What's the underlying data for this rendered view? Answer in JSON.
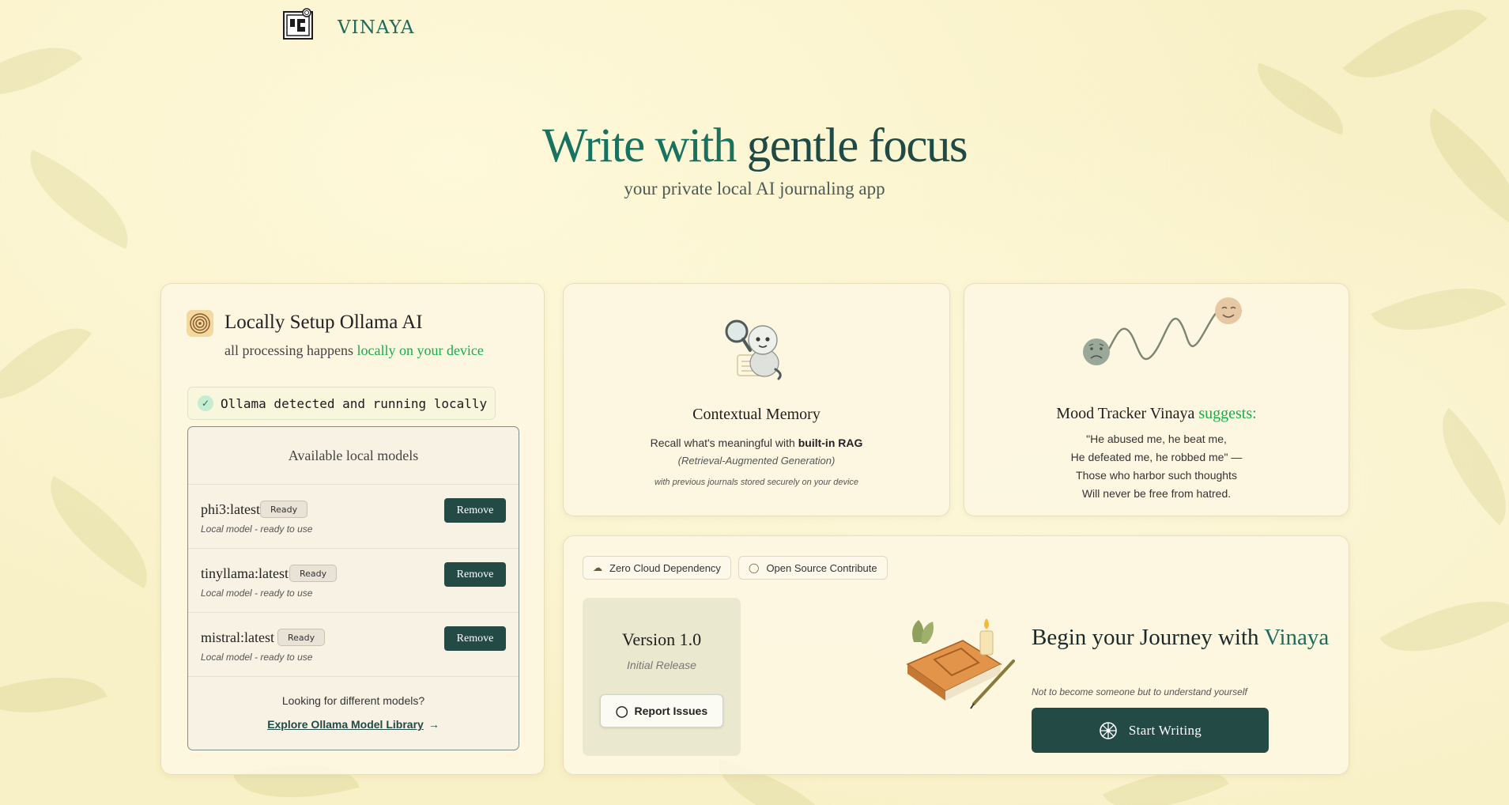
{
  "header": {
    "brand": "VINAYA"
  },
  "hero": {
    "title_part1": "Write with",
    "title_part2": " gentle focus",
    "subtitle": "your private local AI journaling app"
  },
  "ollama": {
    "title": "Locally Setup Ollama AI",
    "subtitle_prefix": "all processing happens ",
    "subtitle_highlight": "locally on your device",
    "status": "Ollama detected and running locally",
    "models_heading": "Available local models",
    "models": [
      {
        "name": "phi3:latest",
        "badge": "Ready",
        "desc": "Local model - ready to use",
        "action": "Remove"
      },
      {
        "name": "tinyllama:latest",
        "badge": "Ready",
        "desc": "Local model - ready to use",
        "action": "Remove"
      },
      {
        "name": "mistral:latest",
        "badge": "Ready",
        "desc": "Local model - ready to use",
        "action": "Remove"
      }
    ],
    "looking_text": "Looking for different models?",
    "explore_link": "Explore Ollama Model Library"
  },
  "memory": {
    "title": "Contextual Memory",
    "desc_prefix": "Recall what's meaningful with ",
    "desc_bold": "built-in RAG",
    "paren": "(Retrieval-Augmented Generation)",
    "note": "with previous journals stored securely on your device"
  },
  "mood": {
    "title_prefix": "Mood Tracker Vinaya ",
    "title_highlight": "suggests:",
    "quote_lines": [
      "\"He abused me, he beat me,",
      "He defeated me, he robbed me\" —",
      "Those who harbor such thoughts",
      "Will never be free from hatred."
    ]
  },
  "journey": {
    "pills": [
      "Zero Cloud Dependency",
      "Open Source Contribute"
    ],
    "version": "Version 1.0",
    "release": "Initial Release",
    "report_button": "Report Issues",
    "title_prefix": "Begin your Journey with ",
    "title_highlight": "Vinaya",
    "subtitle": "Not to become someone but to understand yourself",
    "start_button": "Start Writing"
  },
  "colors": {
    "accent_teal": "#244a46",
    "brand_green": "#17735f",
    "highlight_green": "#1aab4b",
    "background": "#f8f0c6"
  }
}
